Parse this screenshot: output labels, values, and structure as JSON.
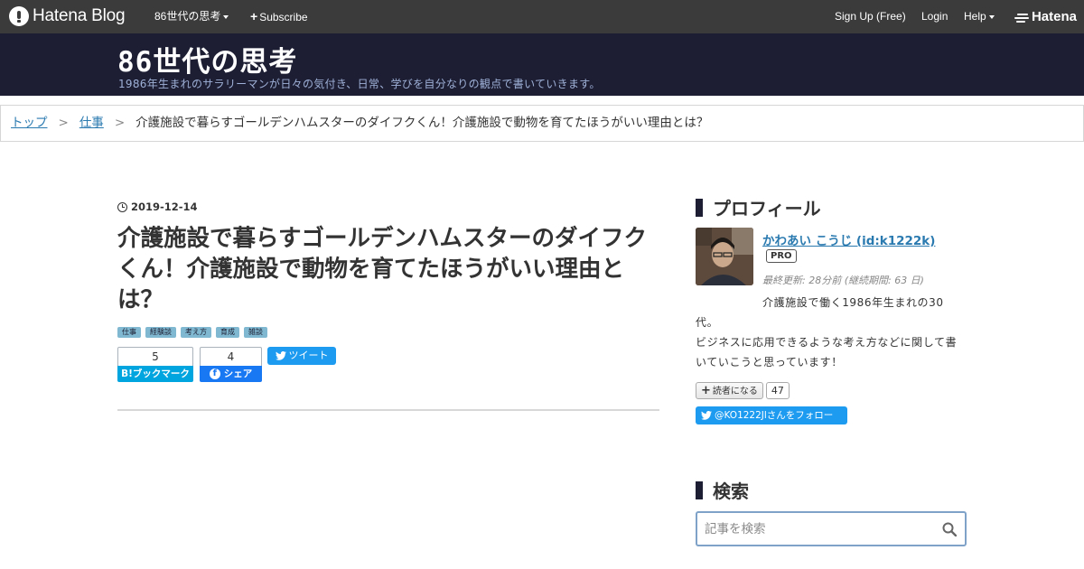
{
  "topbar": {
    "brand": "Hatena Blog",
    "blog_menu": "86世代の思考",
    "subscribe": "Subscribe",
    "signup": "Sign Up (Free)",
    "login": "Login",
    "help": "Help",
    "hatena": "Hatena"
  },
  "header": {
    "title": "86世代の思考",
    "description": "1986年生まれのサラリーマンが日々の気付き、日常、学びを自分なりの観点で書いていきます。"
  },
  "breadcrumb": {
    "top": "トップ",
    "category": "仕事",
    "current": "介護施設で暮らすゴールデンハムスターのダイフクくん！介護施設で動物を育てたほうがいい理由とは？"
  },
  "article": {
    "date": "2019-12-14",
    "title": "介護施設で暮らすゴールデンハムスターのダイフクくん！介護施設で動物を育てたほうがいい理由とは？",
    "tags": [
      "仕事",
      "経験談",
      "考え方",
      "育成",
      "雑談"
    ],
    "hatebu_count": "5",
    "hatebu_label": "B!ブックマーク",
    "fb_count": "4",
    "fb_label": "シェア",
    "tweet_label": "ツイート"
  },
  "sidebar": {
    "profile_title": "プロフィール",
    "profile_name": "かわあい こうじ (id:k1222k)",
    "pro_badge": "PRO",
    "updated": "最終更新: 28分前 (継続期間: 63 日)",
    "desc_line1": "介護施設で働く1986年生まれの30",
    "desc_line2": "代。",
    "desc_line3": "ビジネスに応用できるような考え方などに関して書いていこうと思っています！",
    "subscribe_label": "読者になる",
    "subscriber_count": "47",
    "twitter_follow": "@KO1222Jlさんをフォロー",
    "search_title": "検索",
    "search_placeholder": "記事を検索"
  },
  "colors": {
    "topbar_bg": "#3b3b3b",
    "header_bg": "#1d1e33",
    "link": "#2a7ab0",
    "tag_bg": "#7fb8d0",
    "hatebu": "#00a4de",
    "facebook": "#1877f2",
    "twitter": "#1d9bf0"
  }
}
